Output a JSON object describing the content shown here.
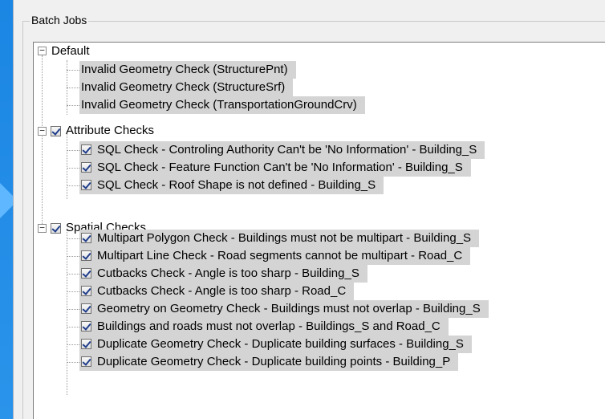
{
  "panel": {
    "title": "Batch Jobs"
  },
  "tree": {
    "default_group": {
      "label": "Default",
      "items": [
        "Invalid Geometry Check (StructurePnt)",
        "Invalid Geometry Check (StructureSrf)",
        "Invalid Geometry Check (TransportationGroundCrv)"
      ]
    },
    "attribute_group": {
      "label": "Attribute Checks",
      "checked": true,
      "items": [
        "SQL Check - Controling Authority Can't be 'No Information' - Building_S",
        "SQL Check - Feature Function Can't be 'No Information' - Building_S",
        "SQL Check - Roof Shape is not defined - Building_S"
      ]
    },
    "spatial_group": {
      "label": "Spatial Checks",
      "checked": true,
      "items": [
        "Multipart Polygon Check - Buildings must not be multipart - Building_S",
        "Multipart Line Check - Road segments cannot be multipart - Road_C",
        "Cutbacks Check - Angle is too sharp - Building_S",
        "Cutbacks Check - Angle is too sharp - Road_C",
        "Geometry on Geometry Check - Buildings must not overlap - Building_S",
        "Buildings and roads must not overlap - Buildings_S and Road_C",
        "Duplicate Geometry Check - Duplicate building surfaces - Building_S",
        "Duplicate Geometry Check - Duplicate building points - Building_P"
      ]
    }
  },
  "colors": {
    "background": "#1f8ae6",
    "selection": "#d4d4d4",
    "check": "#1f3d8c"
  }
}
